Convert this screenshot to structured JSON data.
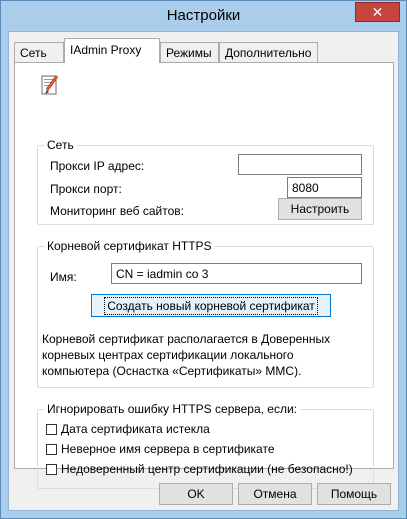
{
  "window": {
    "title": "Настройки",
    "close_label": "✕"
  },
  "tabs": [
    {
      "label": "Сеть",
      "active": false
    },
    {
      "label": "IAdmin Proxy",
      "active": true
    },
    {
      "label": "Режимы",
      "active": false
    },
    {
      "label": "Дополнительно",
      "active": false
    }
  ],
  "network_group": {
    "title": "Сеть",
    "proxy_ip_label": "Прокси IP адрес:",
    "proxy_ip_value": "",
    "proxy_port_label": "Прокси порт:",
    "proxy_port_value": "8080",
    "monitoring_label": "Мониторинг веб сайтов:",
    "configure_button": "Настроить"
  },
  "cert_group": {
    "title": "Корневой сертификат HTTPS",
    "name_label": "Имя:",
    "name_value": "CN = iadmin co 3",
    "create_button": "Создать новый корневой сертификат",
    "info_line1": "Корневой сертификат располагается в Доверенных",
    "info_line2": "корневых центрах сертификации локального",
    "info_line3": "компьютера (Оснастка «Сертификаты» MMC)."
  },
  "ignore_group": {
    "title": "Игнорировать ошибку HTTPS сервера, если:",
    "options": [
      {
        "label": "Дата сертификата истекла",
        "checked": false
      },
      {
        "label": "Неверное имя сервера в сертификате",
        "checked": false
      },
      {
        "label": "Недоверенный центр сертификации (не безопасно!)",
        "checked": false
      }
    ]
  },
  "footer": {
    "ok": "OK",
    "cancel": "Отмена",
    "help": "Помощь"
  },
  "icons": {
    "settings_icon": "document-edit-icon"
  }
}
